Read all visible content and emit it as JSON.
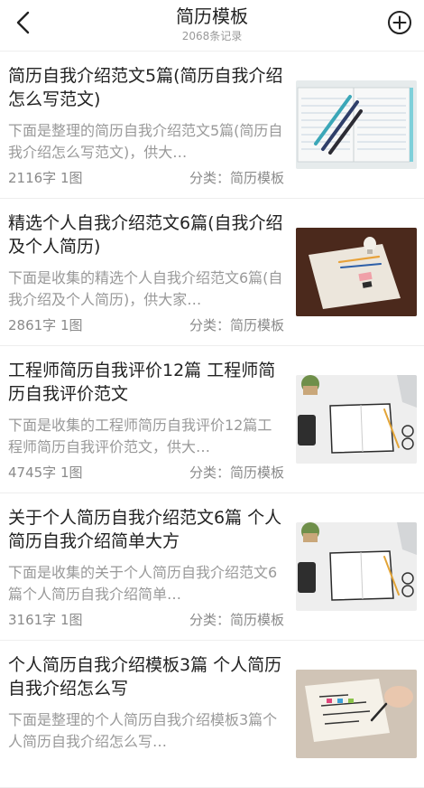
{
  "header": {
    "title": "简历模板",
    "subtitle": "2068条记录",
    "back_icon": "chevron-left-icon",
    "add_icon": "plus-circle-icon"
  },
  "articles": [
    {
      "title": "简历自我介绍范文5篇(简历自我介绍怎么写范文)",
      "desc": "下面是整理的简历自我介绍范文5篇(简历自我介绍怎么写范文)，供大…",
      "words": "2116字",
      "images": "1图",
      "category_label": "分类：",
      "category": "简历模板",
      "thumb": "notebook-pens"
    },
    {
      "title": "精选个人自我介绍范文6篇(自我介绍及个人简历)",
      "desc": "下面是收集的精选个人自我介绍范文6篇(自我介绍及个人简历)，供大家…",
      "words": "2861字",
      "images": "1图",
      "category_label": "分类：",
      "category": "简历模板",
      "thumb": "paper-bulb"
    },
    {
      "title": "工程师简历自我评价12篇 工程师简历自我评价范文",
      "desc": "下面是收集的工程师简历自我评价12篇工程师简历自我评价范文，供大…",
      "words": "4745字",
      "images": "1图",
      "category_label": "分类：",
      "category": "简历模板",
      "thumb": "desk-notebook"
    },
    {
      "title": "关于个人简历自我介绍范文6篇 个人简历自我介绍简单大方",
      "desc": "下面是收集的关于个人简历自我介绍范文6篇个人简历自我介绍简单…",
      "words": "3161字",
      "images": "1图",
      "category_label": "分类：",
      "category": "简历模板",
      "thumb": "desk-notebook"
    },
    {
      "title": "个人简历自我介绍模板3篇 个人简历自我介绍怎么写",
      "desc": "下面是整理的个人简历自我介绍模板3篇个人简历自我介绍怎么写…",
      "words": "",
      "images": "",
      "category_label": "",
      "category": "",
      "thumb": "writing-hand"
    }
  ]
}
